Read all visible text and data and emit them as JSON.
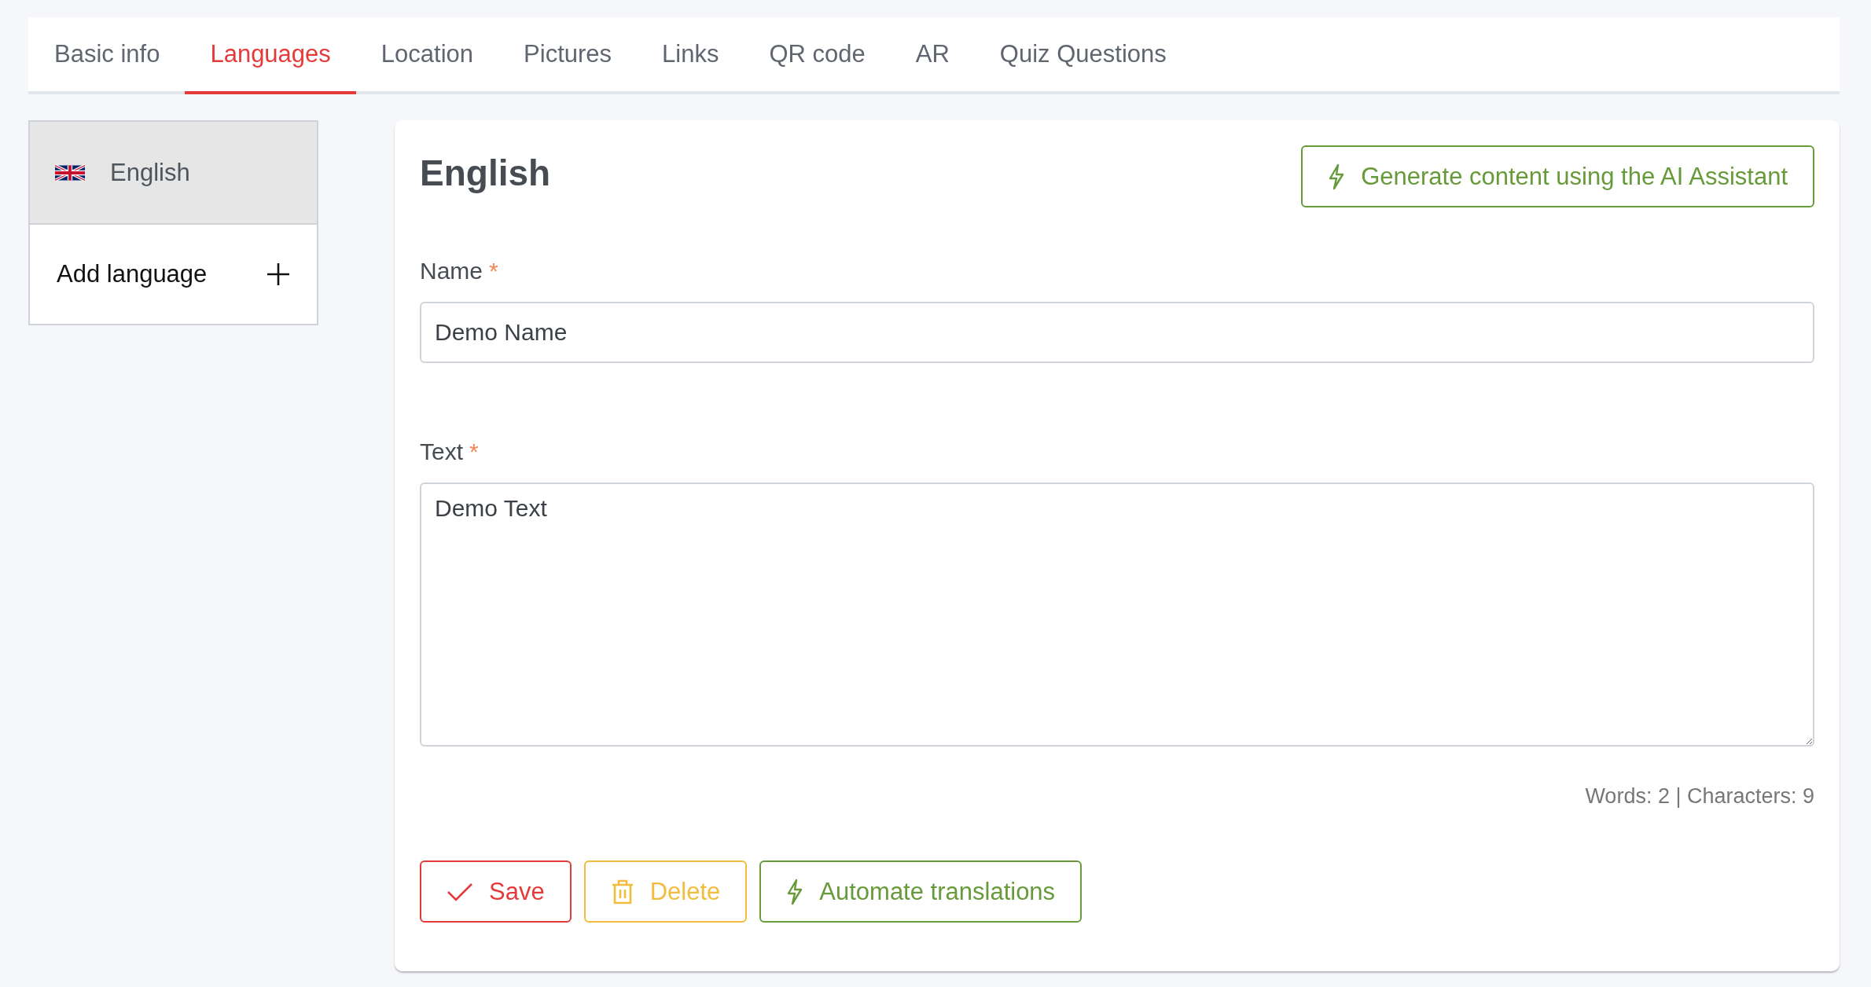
{
  "tabs": [
    {
      "label": "Basic info",
      "selected": false
    },
    {
      "label": "Languages",
      "selected": true
    },
    {
      "label": "Location",
      "selected": false
    },
    {
      "label": "Pictures",
      "selected": false
    },
    {
      "label": "Links",
      "selected": false
    },
    {
      "label": "QR code",
      "selected": false
    },
    {
      "label": "AR",
      "selected": false
    },
    {
      "label": "Quiz Questions",
      "selected": false
    }
  ],
  "languages": [
    {
      "label": "English",
      "selected": true
    }
  ],
  "add_language": {
    "label": "Add language"
  },
  "editor": {
    "heading": "English",
    "ai_button": "Generate content using the AI Assistant",
    "fields": [
      {
        "kind": "input",
        "label": "Name",
        "required_mark": "*",
        "value": "Demo Name"
      },
      {
        "kind": "textarea",
        "label": "Text",
        "required_mark": "*",
        "value": "Demo Text"
      }
    ],
    "counter": "Words: 2 | Characters: 9",
    "buttons": [
      {
        "kind": "save",
        "label": "Save"
      },
      {
        "kind": "delete",
        "label": "Delete"
      },
      {
        "kind": "automate",
        "label": "Automate translations"
      }
    ]
  }
}
